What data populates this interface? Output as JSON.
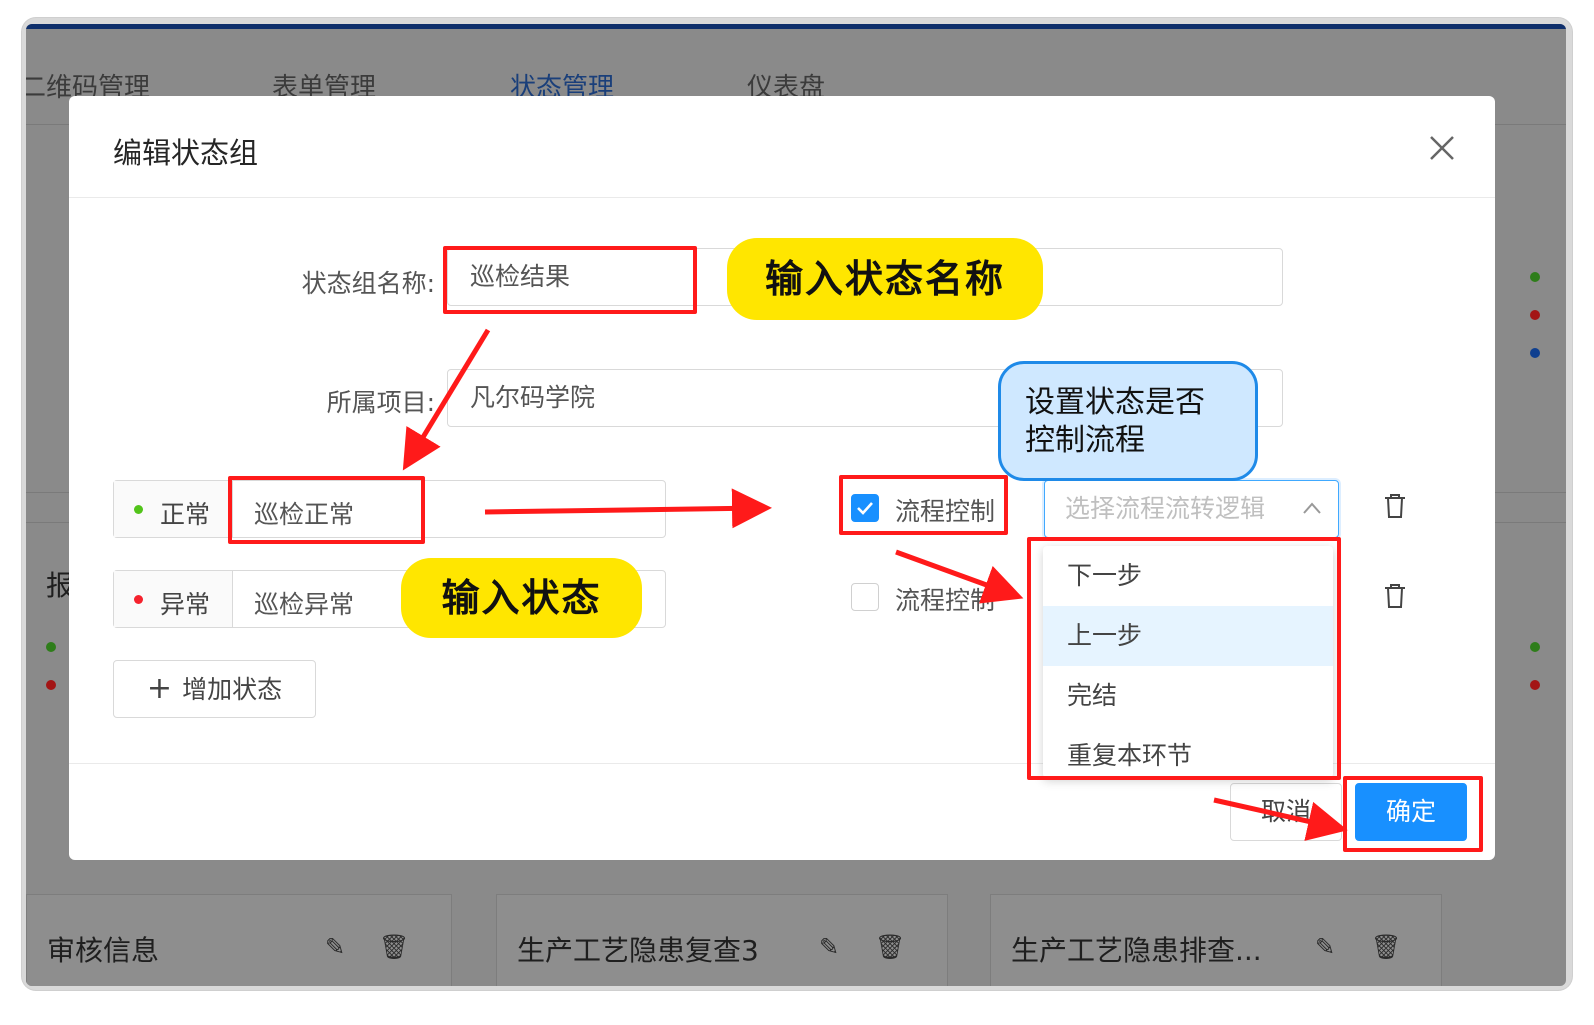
{
  "nav": {
    "items": [
      "二维码管理",
      "表单管理",
      "状态管理",
      "仪表盘"
    ],
    "active_index": 2
  },
  "background": {
    "left_label": "报",
    "cards": [
      {
        "title": "审核信息"
      },
      {
        "title": "生产工艺隐患复查3"
      },
      {
        "title": "生产工艺隐患排查..."
      }
    ]
  },
  "modal": {
    "title": "编辑状态组",
    "group_name_label": "状态组名称:",
    "group_name_value": "巡检结果",
    "project_label": "所属项目:",
    "project_value": "凡尔码学院",
    "states": [
      {
        "tag": "正常",
        "dot_color": "#52c41a",
        "value": "巡检正常",
        "flow_control_label": "流程控制",
        "checked": true,
        "select_placeholder": "选择流程流转逻辑"
      },
      {
        "tag": "异常",
        "dot_color": "#f5222d",
        "value": "巡检异常",
        "flow_control_label": "流程控制",
        "checked": false
      }
    ],
    "add_state_label": "增加状态",
    "dropdown_options": [
      "下一步",
      "上一步",
      "完结",
      "重复本环节"
    ],
    "dropdown_highlight_index": 1,
    "cancel_label": "取消",
    "ok_label": "确定"
  },
  "callouts": {
    "input_state_name": "输入状态名称",
    "input_state": "输入状态",
    "flow_control": "设置状态是否控制流程"
  },
  "colors": {
    "primary": "#1890ff",
    "annotation_red": "#ff1a1a",
    "callout_yellow": "#ffe600",
    "callout_blue": "#cfe8ff"
  }
}
